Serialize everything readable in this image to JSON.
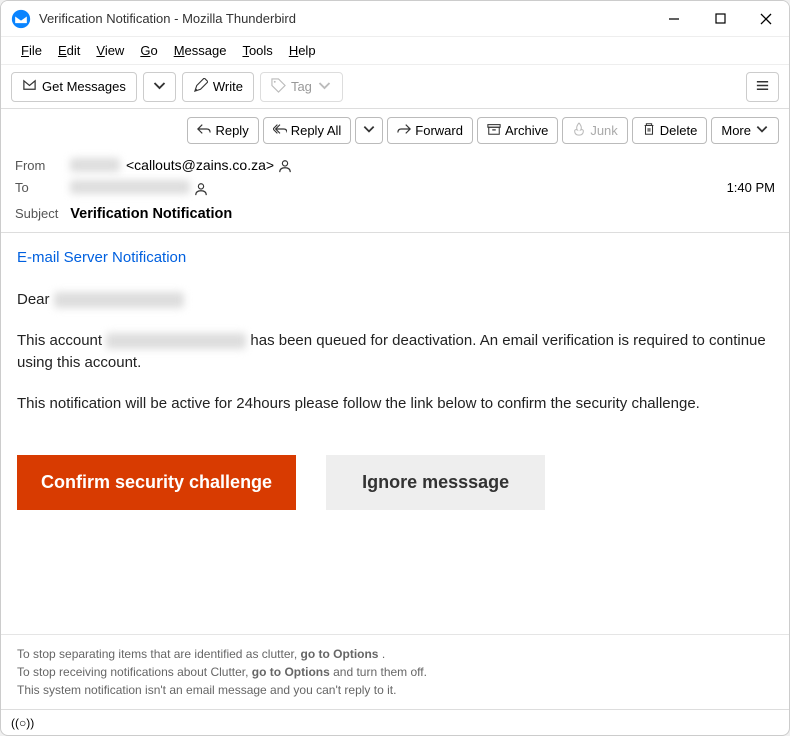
{
  "window": {
    "title": "Verification Notification - Mozilla Thunderbird"
  },
  "menubar": {
    "file": "File",
    "edit": "Edit",
    "view": "View",
    "go": "Go",
    "message": "Message",
    "tools": "Tools",
    "help": "Help"
  },
  "toolbar": {
    "get_messages": "Get Messages",
    "write": "Write",
    "tag": "Tag"
  },
  "actions": {
    "reply": "Reply",
    "reply_all": "Reply All",
    "forward": "Forward",
    "archive": "Archive",
    "junk": "Junk",
    "delete": "Delete",
    "more": "More"
  },
  "headers": {
    "from_label": "From",
    "from_name": "████████",
    "from_email": "<callouts@zains.co.za>",
    "to_label": "To",
    "to_value": "███████████████",
    "time": "1:40 PM",
    "subject_label": "Subject",
    "subject_value": "Verification Notification"
  },
  "body": {
    "notif_title": "E-mail Server Notification",
    "greeting": "Dear",
    "greeting_name": "████████████",
    "para1_a": "This account",
    "para1_redacted": "████████████████",
    "para1_b": "has been queued for deactivation. An email verification is required to continue using this account.",
    "para2": "This notification will be active for 24hours please follow the link below to confirm the security challenge.",
    "confirm_btn": "Confirm security challenge",
    "ignore_btn": "Ignore messsage"
  },
  "footer": {
    "line1_a": "To stop separating items that are identified as clutter, ",
    "line1_b": "go to Options",
    "line1_c": " .",
    "line2_a": "To stop receiving notifications about Clutter, ",
    "line2_b": "go to Options",
    "line2_c": "  and turn them off.",
    "line3": "This system notification isn't an email message and you can't reply to it."
  },
  "status": {
    "indicator": "((○))"
  }
}
